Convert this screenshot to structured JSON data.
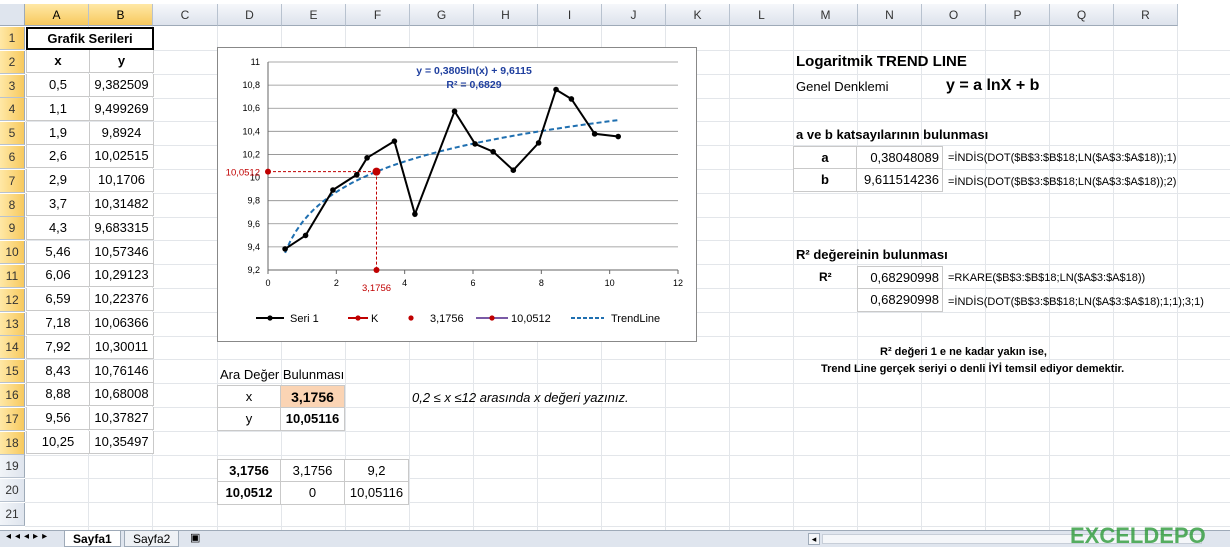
{
  "columns": [
    "A",
    "B",
    "C",
    "D",
    "E",
    "F",
    "G",
    "H",
    "I",
    "J",
    "K",
    "L",
    "M",
    "N",
    "O",
    "P",
    "Q",
    "R"
  ],
  "rows": [
    "1",
    "2",
    "3",
    "4",
    "5",
    "6",
    "7",
    "8",
    "9",
    "10",
    "11",
    "12",
    "13",
    "14",
    "15",
    "16",
    "17",
    "18",
    "19",
    "20",
    "21"
  ],
  "table": {
    "title": "Grafik Serileri",
    "header": [
      "x",
      "y"
    ],
    "rows": [
      [
        "0,5",
        "9,382509"
      ],
      [
        "1,1",
        "9,499269"
      ],
      [
        "1,9",
        "9,8924"
      ],
      [
        "2,6",
        "10,02515"
      ],
      [
        "2,9",
        "10,1706"
      ],
      [
        "3,7",
        "10,31482"
      ],
      [
        "4,3",
        "9,683315"
      ],
      [
        "5,46",
        "10,57346"
      ],
      [
        "6,06",
        "10,29123"
      ],
      [
        "6,59",
        "10,22376"
      ],
      [
        "7,18",
        "10,06366"
      ],
      [
        "7,92",
        "10,30011"
      ],
      [
        "8,43",
        "10,76146"
      ],
      [
        "8,88",
        "10,68008"
      ],
      [
        "9,56",
        "10,37827"
      ],
      [
        "10,25",
        "10,35497"
      ]
    ]
  },
  "chart_data": {
    "type": "scatter",
    "equation": "y = 0,3805ln(x) + 9,6115",
    "r2": "R² = 0,6829",
    "x_ticks": [
      "0",
      "2",
      "4",
      "6",
      "8",
      "10",
      "12"
    ],
    "y_ticks": [
      "9,2",
      "9,4",
      "9,6",
      "9,8",
      "10",
      "10,2",
      "10,4",
      "10,6",
      "10,8",
      "11"
    ],
    "xlim": [
      0,
      12
    ],
    "ylim": [
      9.2,
      11
    ],
    "series": [
      {
        "name": "Seri 1",
        "x": [
          0.5,
          1.1,
          1.9,
          2.6,
          2.9,
          3.7,
          4.3,
          5.46,
          6.06,
          6.59,
          7.18,
          7.92,
          8.43,
          8.88,
          9.56,
          10.25
        ],
        "y": [
          9.382509,
          9.499269,
          9.8924,
          10.02515,
          10.1706,
          10.31482,
          9.683315,
          10.57346,
          10.29123,
          10.22376,
          10.06366,
          10.30011,
          10.76146,
          10.68008,
          10.37827,
          10.35497
        ]
      }
    ],
    "trend": {
      "a": 0.38048089,
      "b": 9.611514236,
      "x_from": 0.5,
      "x_to": 10.25
    },
    "point_x": 3.1756,
    "point_y": 10.0512,
    "x_marker_label": "3,1756",
    "y_marker_label": "10,0512",
    "legend": [
      "Seri 1",
      "K",
      "3,1756",
      "10,0512",
      "TrendLine"
    ],
    "colors": {
      "series": "#000000",
      "trend": "#1f6fb0",
      "marker": "#c00000",
      "legend_purple": "#7a5aa6"
    }
  },
  "ara": {
    "title": "Ara Değer Bulunması",
    "x_label": "x",
    "x_value": "3,1756",
    "y_label": "y",
    "y_value": "10,05116",
    "hint": "0,2 ≤ x ≤12  arasında  x  değeri yazınız."
  },
  "small_table": [
    [
      "3,1756",
      "3,1756",
      "9,2"
    ],
    [
      "10,0512",
      "0",
      "10,05116"
    ]
  ],
  "right": {
    "title": "Logaritmik TREND LINE",
    "genel": "Genel Denklemi",
    "equation": "y = a lnX + b",
    "katsayi_title": "a ve b katsayılarının bulunması",
    "a_label": "a",
    "a_value": "0,38048089",
    "a_formula": "=İNDİS(DOT($B$3:$B$18;LN($A$3:$A$18));1)",
    "b_label": "b",
    "b_value": "9,611514236",
    "b_formula": "=İNDİS(DOT($B$3:$B$18;LN($A$3:$A$18));2)",
    "r2_title": "R²  değereinin bulunması",
    "r2_label": "R²",
    "r2_value1": "0,68290998",
    "r2_formula1": "=RKARE($B$3:$B$18;LN($A$3:$A$18))",
    "r2_value2": "0,68290998",
    "r2_formula2": "=İNDİS(DOT($B$3:$B$18;LN($A$3:$A$18);1;1);3;1)",
    "note1": "R²  değeri  1 e ne kadar yakın ise,",
    "note2": "Trend Line gerçek seriyi o denli İYİ temsil ediyor demektir."
  },
  "tabs": {
    "sheet1": "Sayfa1",
    "sheet2": "Sayfa2"
  },
  "watermark": "EXCELDEPO"
}
